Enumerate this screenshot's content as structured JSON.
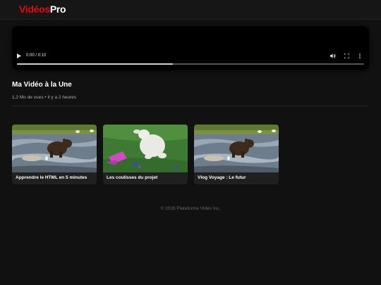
{
  "header": {
    "logo_part1": "Vidéos",
    "logo_part2": "Pro",
    "logo_colors": {
      "accent": "#e50914",
      "light": "#ffffff"
    }
  },
  "player": {
    "time_display": "0 / 0:10",
    "current_time": "0:00",
    "duration": "0:10",
    "progress_fraction": 0.45,
    "icons": {
      "play": "play-icon",
      "volume": "volume-icon",
      "fullscreen": "fullscreen-icon",
      "more": "more-vertical-icon"
    }
  },
  "video": {
    "title": "Ma Vidéo à la Une",
    "meta": "1,2 Mo de vues • Il y a 2 heures"
  },
  "recommendations": [
    {
      "title": "Apprendre le HTML en 5 minutes",
      "thumbnail": "bear-in-river"
    },
    {
      "title": "Les coulisses du projet",
      "thumbnail": "rabbit-on-grass"
    },
    {
      "title": "Vlog Voyage : Le futur",
      "thumbnail": "bear-in-river"
    }
  ],
  "footer": {
    "text": "© 2026 Plateforme Vidéo Inc."
  },
  "colors": {
    "background": "#111111",
    "card": "#202020",
    "muted": "#aaaaaa"
  }
}
